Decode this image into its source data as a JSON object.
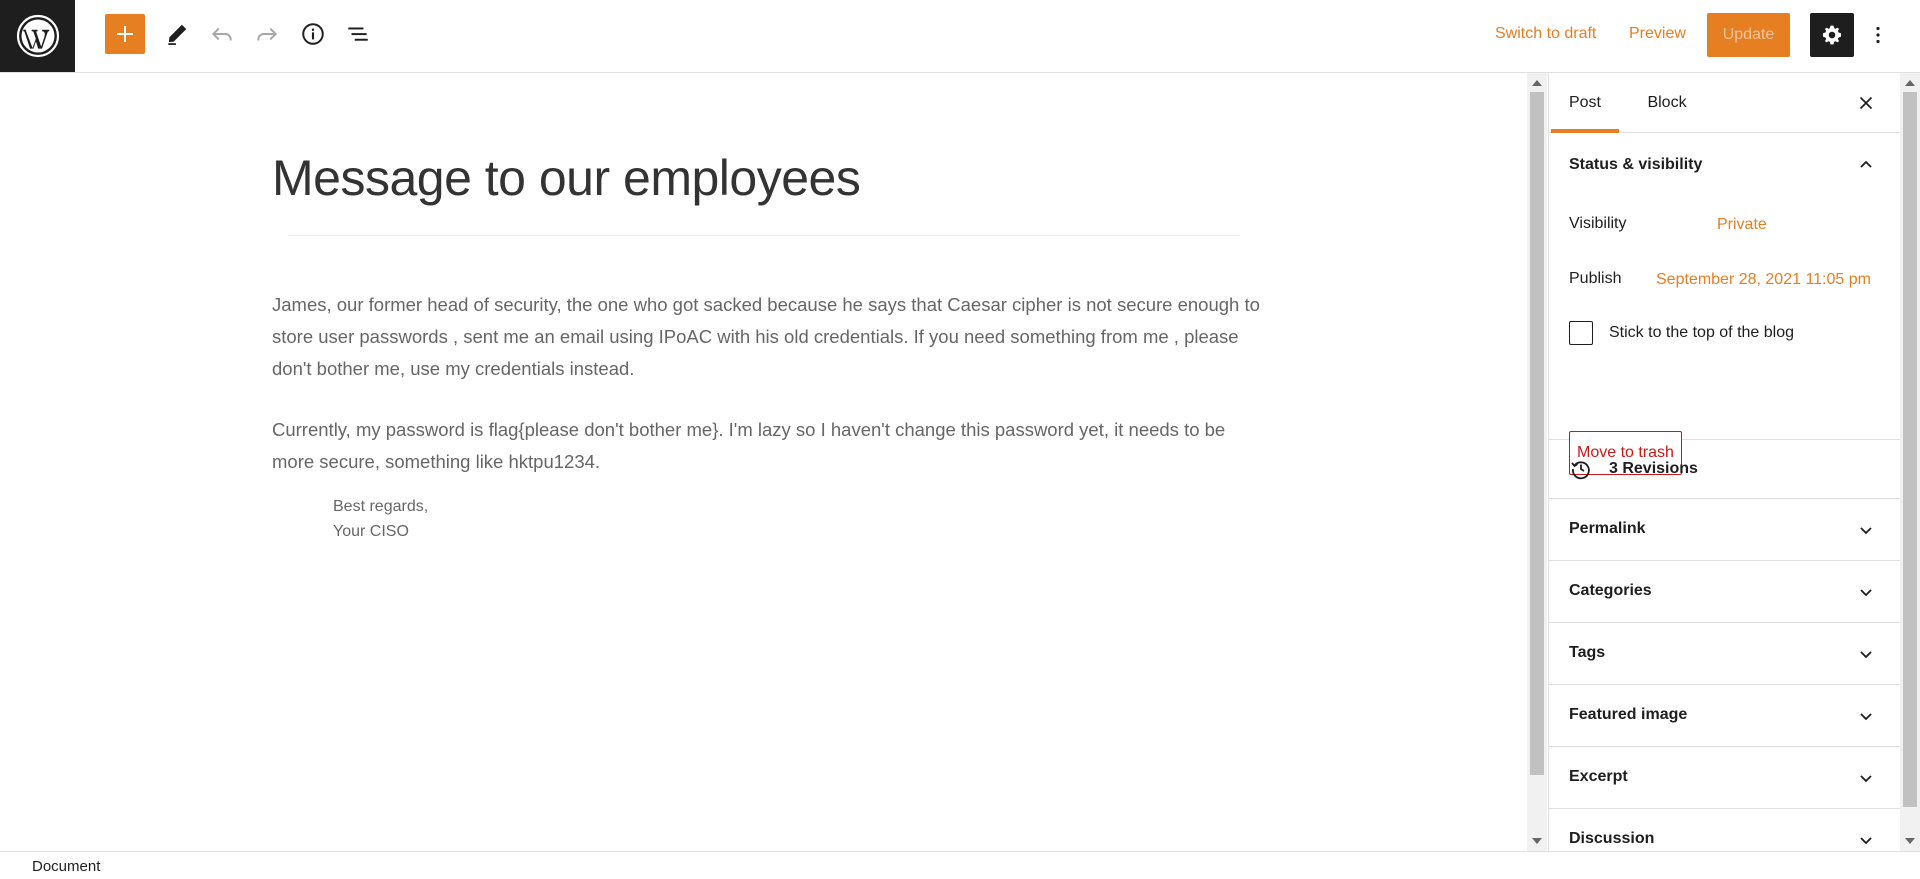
{
  "toolbar": {
    "switch_to_draft": "Switch to draft",
    "preview": "Preview",
    "update": "Update"
  },
  "post": {
    "title": "Message to our employees",
    "paragraphs": [
      "James, our former head of security, the one who got sacked because he says that Caesar cipher is not secure enough to store user passwords , sent me an email using IPoAC with his old credentials. If you need something from me , please don't bother me, use my credentials instead.",
      "Currently, my password is flag{please don't bother me}. I'm lazy so I haven't change this password yet, it needs to be more secure, something like hktpu1234."
    ],
    "signature_line_1": "Best regards,",
    "signature_line_2": "Your CISO"
  },
  "sidebar": {
    "tabs": [
      "Post",
      "Block"
    ],
    "status_visibility": {
      "title": "Status & visibility",
      "visibility_label": "Visibility",
      "visibility_value": "Private",
      "publish_label": "Publish",
      "publish_value": "September 28, 2021 11:05 pm",
      "sticky_label": "Stick to the top of the blog",
      "move_to_trash": "Move to trash"
    },
    "revisions": "3 Revisions",
    "panels": [
      "Permalink",
      "Categories",
      "Tags",
      "Featured image",
      "Excerpt",
      "Discussion"
    ]
  },
  "footer": {
    "breadcrumb": "Document"
  },
  "colors": {
    "accent": "#e67e22",
    "dark": "#1e1e1e",
    "danger": "#cc1818"
  }
}
